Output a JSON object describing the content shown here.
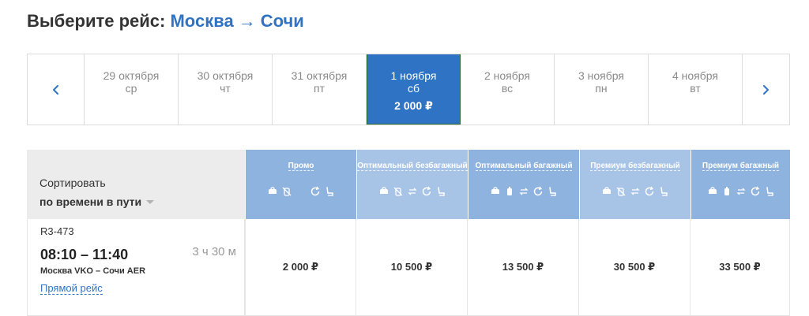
{
  "header": {
    "prefix": "Выберите рейс:",
    "from": "Москва",
    "arrow": "→",
    "to": "Сочи"
  },
  "dates": [
    {
      "date": "29 октября",
      "dow": "ср",
      "price": "",
      "active": false
    },
    {
      "date": "30 октября",
      "dow": "чт",
      "price": "",
      "active": false
    },
    {
      "date": "31 октября",
      "dow": "пт",
      "price": "",
      "active": false
    },
    {
      "date": "1 ноября",
      "dow": "сб",
      "price": "2 000 ₽",
      "active": true
    },
    {
      "date": "2 ноября",
      "dow": "вс",
      "price": "",
      "active": false
    },
    {
      "date": "3 ноября",
      "dow": "пн",
      "price": "",
      "active": false
    },
    {
      "date": "4 ноября",
      "dow": "вт",
      "price": "",
      "active": false
    }
  ],
  "sort": {
    "label": "Сортировать",
    "value": "по времени в пути"
  },
  "fares": [
    {
      "name": "Промо",
      "icons": [
        "bag-icon",
        "no-baggage-icon",
        "no-change-icon",
        "refund-icon",
        "seat-icon"
      ]
    },
    {
      "name": "Оптимальный безбагажный",
      "icons": [
        "bag-icon",
        "no-baggage-icon",
        "change-icon",
        "refund-icon",
        "seat-icon"
      ]
    },
    {
      "name": "Оптимальный багажный",
      "icons": [
        "bag-icon",
        "baggage-icon",
        "change-icon",
        "refund-icon",
        "seat-icon"
      ]
    },
    {
      "name": "Премиум безбагажный",
      "icons": [
        "bag-icon",
        "no-baggage-icon",
        "change-icon",
        "refund-icon",
        "seat-icon"
      ]
    },
    {
      "name": "Премиум багажный",
      "icons": [
        "bag-icon",
        "baggage-icon",
        "change-icon",
        "refund-icon",
        "seat-icon"
      ]
    }
  ],
  "flight": {
    "number": "R3-473",
    "times": "08:10 – 11:40",
    "duration": "3 ч 30 м",
    "route": "Москва VKO – Сочи AER",
    "type_link": "Прямой рейс",
    "prices": [
      "2 000 ₽",
      "10 500 ₽",
      "13 500 ₽",
      "30 500 ₽",
      "33 500 ₽"
    ]
  },
  "colors": {
    "accent": "#2f73c4",
    "fare_header": "#8fb3df",
    "fare_header_alt": "#a7c3e6",
    "sort_bg": "#ececec"
  }
}
